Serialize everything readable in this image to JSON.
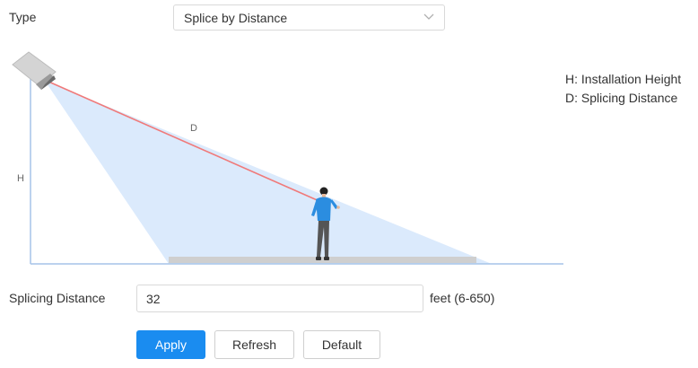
{
  "type_row": {
    "label": "Type",
    "selected": "Splice by Distance"
  },
  "diagram": {
    "height_marker": "H",
    "distance_marker": "D"
  },
  "legend": {
    "line1": "H: Installation Height",
    "line2": "D: Splicing Distance"
  },
  "distance_row": {
    "label": "Splicing Distance",
    "value": "32",
    "unit_range": "feet (6-650)"
  },
  "buttons": {
    "apply": "Apply",
    "refresh": "Refresh",
    "default": "Default"
  },
  "colors": {
    "primary": "#1a8cf0",
    "coverage": "#dbeafc",
    "distance_line": "#f07a7a",
    "axis": "#a6c4e8"
  }
}
